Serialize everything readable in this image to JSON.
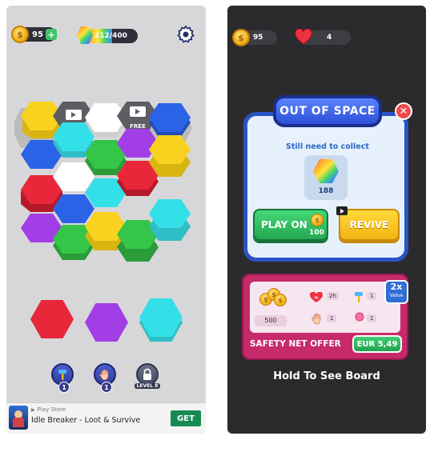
{
  "left_screen": {
    "coins": "95",
    "progress_text": "212/400",
    "progress_fraction": 0.53,
    "board_tile_labels": {
      "free": "FREE"
    },
    "boosters": [
      {
        "name": "hammer",
        "count": "1"
      },
      {
        "name": "hand",
        "count": "1"
      },
      {
        "name": "lock",
        "label": "LEVEL 8"
      }
    ],
    "ad": {
      "store": "Play Store",
      "title": "Idle Breaker - Loot & Survive",
      "cta": "GET"
    }
  },
  "right_screen": {
    "coins": "95",
    "lives": "4",
    "dialog": {
      "title": "OUT OF SPACE",
      "subtitle": "Still need to collect",
      "collect_count": "188",
      "play_on_label": "PLAY ON",
      "play_on_cost": "100",
      "revive_label": "REVIVE"
    },
    "offer": {
      "coins": "500",
      "time": "2h",
      "hammer_count": "1",
      "hand_count": "1",
      "lollipop_count": "1",
      "badge_top": "2x",
      "badge_bottom": "Value",
      "label": "SAFETY NET OFFER",
      "price": "EUR 5,49"
    },
    "footer": "Hold To See Board"
  },
  "colors": {
    "yellow": "#f9d21f",
    "blue": "#2b63e6",
    "cyan": "#34e0e8",
    "green": "#35c548",
    "red": "#e8273a",
    "purple": "#a23ee6",
    "white": "#ffffff",
    "dialog_blue": "#2b53c7",
    "offer_pink": "#c62a6a"
  }
}
